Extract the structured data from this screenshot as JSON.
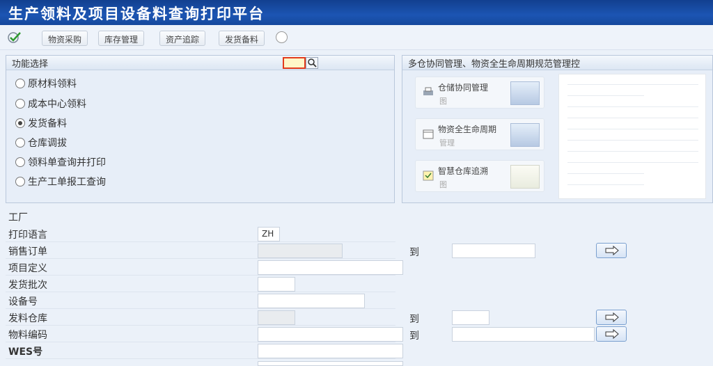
{
  "app": {
    "title": "生产领料及项目设备料查询打印平台"
  },
  "toolbar": {
    "buttons": [
      "物资采购",
      "库存管理",
      "资产追踪",
      "发货备料"
    ]
  },
  "left_panel": {
    "title": "功能选择",
    "options": [
      "原材料领料",
      "成本中心领料",
      "发货备料",
      "仓库调拔",
      "领料单查询并打印",
      "生产工单报工查询"
    ],
    "selected_index": 2
  },
  "right_panel": {
    "title": "多仓协同管理、物资全生命周期规范管理控",
    "cards": [
      {
        "title": "仓储协同管理",
        "subtitle": "图"
      },
      {
        "title": "物资全生命周期",
        "subtitle": "管理"
      },
      {
        "title": "智慧仓库追溯",
        "subtitle": "图"
      }
    ]
  },
  "form": {
    "section_label": "工厂",
    "to_label": "到",
    "rows": [
      {
        "label": "打印语言",
        "value": "ZH"
      },
      {
        "label": "销售订单",
        "value": ""
      },
      {
        "label": "项目定义",
        "value": ""
      },
      {
        "label": "发货批次",
        "value": ""
      },
      {
        "label": "设备号",
        "value": ""
      },
      {
        "label": "发料仓库",
        "value": ""
      },
      {
        "label": "物料编码",
        "value": ""
      },
      {
        "label": "WES号",
        "value": ""
      }
    ]
  },
  "colors": {
    "title_bar": "#1c55b3",
    "panel_bg": "#e7eef8",
    "accent_red": "#e23b1d"
  }
}
